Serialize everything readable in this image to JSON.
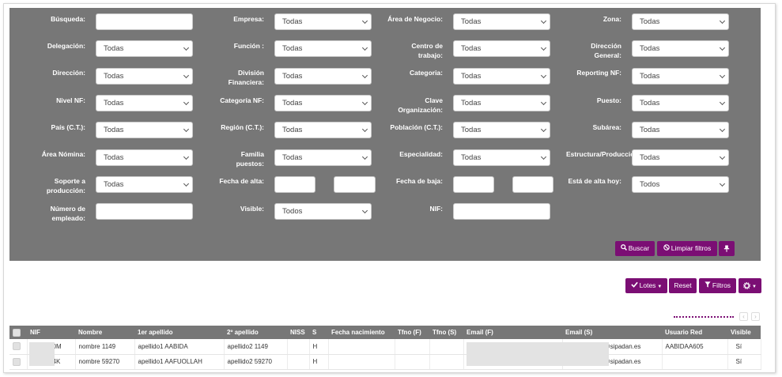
{
  "filters": {
    "busqueda": {
      "label": "Búsqueda:",
      "value": ""
    },
    "empresa": {
      "label": "Empresa:",
      "value": "Todas"
    },
    "area_negocio": {
      "label": "Área de Negocio:",
      "value": "Todas"
    },
    "zona": {
      "label": "Zona:",
      "value": "Todas"
    },
    "delegacion": {
      "label": "Delegación:",
      "value": "Todas"
    },
    "funcion": {
      "label": "Función :",
      "value": "Todas"
    },
    "centro_trabajo": {
      "label": "Centro de trabajo:",
      "value": "Todas"
    },
    "direccion_general": {
      "label": "Dirección General:",
      "value": "Todas"
    },
    "direccion": {
      "label": "Dirección:",
      "value": "Todas"
    },
    "division_financiera": {
      "label": "División Financiera:",
      "value": "Todas"
    },
    "categoria": {
      "label": "Categoria:",
      "value": "Todas"
    },
    "reporting_nf": {
      "label": "Reporting NF:",
      "value": "Todas"
    },
    "nivel_nf": {
      "label": "Nivel NF:",
      "value": "Todas"
    },
    "categoria_nf": {
      "label": "Categoría NF:",
      "value": "Todas"
    },
    "clave_organizacion": {
      "label": "Clave Organización:",
      "value": "Todas"
    },
    "puesto": {
      "label": "Puesto:",
      "value": "Todas"
    },
    "pais": {
      "label": "País (C.T.):",
      "value": "Todas"
    },
    "region": {
      "label": "Región (C.T.):",
      "value": "Todas"
    },
    "poblacion": {
      "label": "Población (C.T.):",
      "value": "Todas"
    },
    "subarea": {
      "label": "Subárea:",
      "value": "Todas"
    },
    "area_nomina": {
      "label": "Área Nómina:",
      "value": "Todas"
    },
    "familia_puestos": {
      "label": "Familia puestos:",
      "value": "Todas"
    },
    "especialidad": {
      "label": "Especialidad:",
      "value": "Todas"
    },
    "estructura_produccion": {
      "label": "Estructura/Producción:",
      "value": "Todas"
    },
    "soporte_produccion": {
      "label": "Soporte a producción:",
      "value": "Todas"
    },
    "fecha_alta": {
      "label": "Fecha de alta:",
      "from": "",
      "to": ""
    },
    "fecha_baja": {
      "label": "Fecha de baja:",
      "from": "",
      "to": ""
    },
    "esta_alta_hoy": {
      "label": "Está de alta hoy:",
      "value": "Todos"
    },
    "numero_empleado": {
      "label": "Número de empleado:",
      "value": ""
    },
    "visible": {
      "label": "Visible:",
      "value": "Todos"
    },
    "nif": {
      "label": "NIF:",
      "value": ""
    }
  },
  "panel_buttons": {
    "buscar": "Buscar",
    "limpiar": "Limpiar filtros",
    "pin_icon": "pin-icon"
  },
  "toolbar": {
    "lotes": "Lotes",
    "reset": "Reset",
    "filtros": "Filtros",
    "settings_icon": "gear-icon"
  },
  "pager": {
    "prev": "‹",
    "next": "›"
  },
  "table": {
    "columns": [
      "NIF",
      "Nombre",
      "1er apellido",
      "2º apellido",
      "NISS",
      "S",
      "Fecha nacimiento",
      "Tfno (F)",
      "Tfno (S)",
      "Email (F)",
      "Email (S)",
      "Usuario Red",
      "Visible"
    ],
    "rows": [
      {
        "nif": "0M",
        "nombre": "nombre 1149",
        "apellido1": "apellido1 AABIDA",
        "apellido2": "apellido2 1149",
        "niss": "",
        "s": "H",
        "fnac": "",
        "tfnof": "",
        "tfnos": "",
        "emailf": "",
        "emails": "@sipadan.es",
        "usuario": "AABIDAA605",
        "visible": "Sí"
      },
      {
        "nif": "4K",
        "nombre": "nombre 59270",
        "apellido1": "apellido1 AAFUOLLAH",
        "apellido2": "apellido2 59270",
        "niss": "",
        "s": "H",
        "fnac": "",
        "tfnof": "",
        "tfnos": "",
        "emailf": "",
        "emails": "@sipadan.es",
        "usuario": "",
        "visible": "Sí"
      }
    ]
  },
  "colors": {
    "panel": "#777777",
    "accent": "#7b0e74"
  }
}
